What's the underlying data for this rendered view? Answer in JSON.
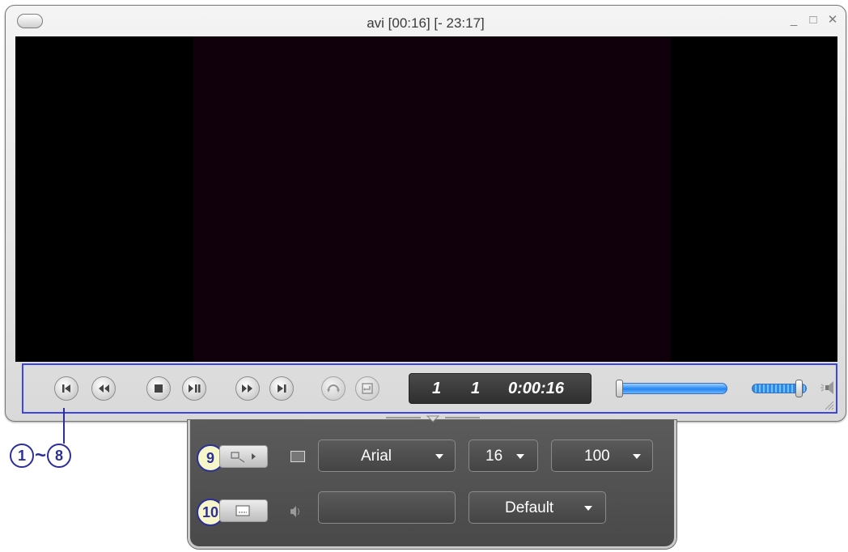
{
  "window": {
    "title": "avi [00:16] [- 23:17]",
    "controls": {
      "minimize": "_",
      "maximize": "□",
      "close": "✕"
    }
  },
  "playback": {
    "buttons": [
      "skip-previous",
      "rewind",
      "stop",
      "play-pause",
      "fast-forward",
      "skip-next",
      "repeat",
      "enter-chapter"
    ],
    "display": {
      "field_a": "1",
      "field_b": "1",
      "time": "0:00:16"
    },
    "seek_position": 0.0,
    "volume_level": 0.92
  },
  "callout": {
    "start": "1",
    "sep": "~",
    "end": "8"
  },
  "extension_panel": {
    "subtitle_row": {
      "badge": "9",
      "font": "Arial",
      "size": "16",
      "percent": "100"
    },
    "audio_row": {
      "badge": "10",
      "track": "",
      "preset": "Default"
    }
  },
  "colors": {
    "highlight": "#3c45e6",
    "annotation": "#2c2f9a",
    "seek": "#2585f0"
  }
}
